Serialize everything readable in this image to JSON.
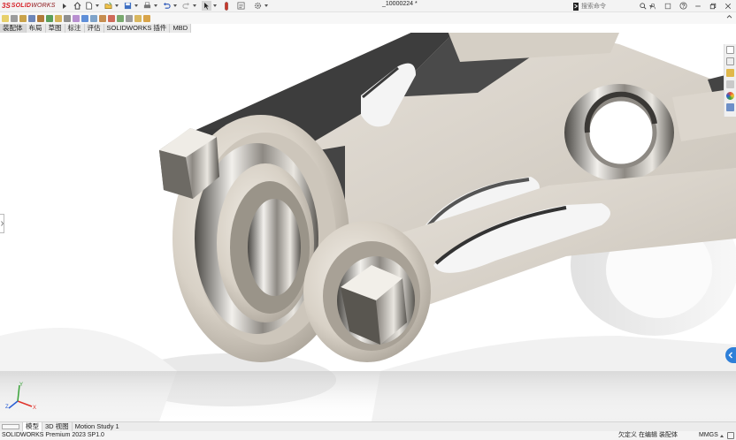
{
  "app": {
    "logo_mark": "3S",
    "logo_solid": "SOLID",
    "logo_works": "WORKS",
    "document_title": "_10000224 *",
    "search_placeholder": "搜索命令"
  },
  "command_tabs": [
    {
      "label": "装配体",
      "active": true
    },
    {
      "label": "布局",
      "active": false
    },
    {
      "label": "草图",
      "active": false
    },
    {
      "label": "标注",
      "active": false
    },
    {
      "label": "评估",
      "active": false
    },
    {
      "label": "SOLIDWORKS 插件",
      "active": false
    },
    {
      "label": "MBD",
      "active": false
    }
  ],
  "bottom_tabs": [
    {
      "label": "模型",
      "active": true
    },
    {
      "label": "3D 视图",
      "active": false
    },
    {
      "label": "Motion Study 1",
      "active": false
    }
  ],
  "status_bar": {
    "product": "SOLIDWORKS Premium 2023 SP1.0",
    "definition_status": "欠定义",
    "edit_status": "在编辑 装配体",
    "units": "MMGS"
  },
  "triad": {
    "x_label": "X",
    "y_label": "Y",
    "z_label": "Z"
  },
  "colors": {
    "brand_red": "#d62027",
    "task_pane_accent": "#2e7fd8",
    "triad_x": "#e0342c",
    "triad_y": "#3aa339",
    "triad_z": "#2b5fd4"
  },
  "icons": {
    "home": "home-icon",
    "new": "new-document-icon",
    "open": "open-icon",
    "save": "save-icon",
    "print": "print-icon",
    "undo": "undo-icon",
    "redo": "redo-icon",
    "select": "select-arrow-icon",
    "rebuild": "rebuild-icon",
    "file_properties": "file-properties-icon",
    "options": "gear-icon",
    "search": "search-icon",
    "user": "user-icon",
    "help": "help-icon"
  }
}
